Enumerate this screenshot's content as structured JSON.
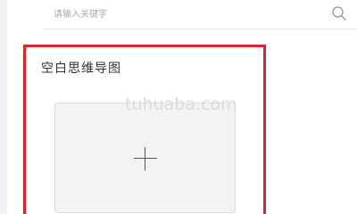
{
  "search": {
    "placeholder": "请输入关键字",
    "icon": "search-icon"
  },
  "template_card": {
    "title": "空白思维导图",
    "new_tile_icon": "plus-icon",
    "highlight_color": "#d9262c"
  },
  "watermark": {
    "text": "tuhuaba.com"
  }
}
